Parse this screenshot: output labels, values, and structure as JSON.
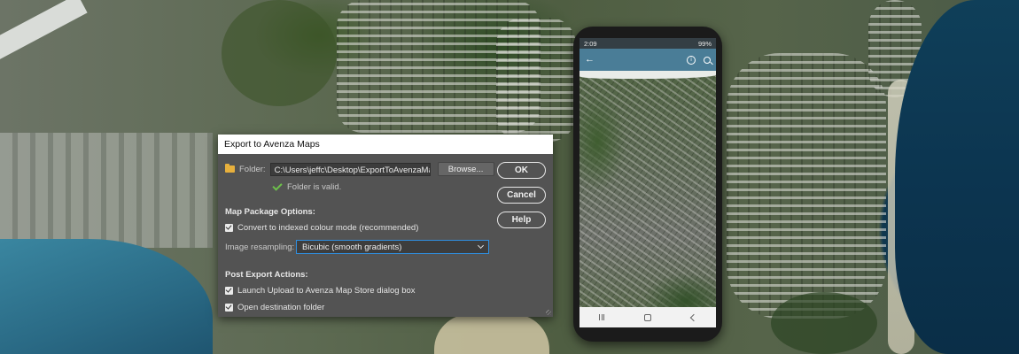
{
  "dialog": {
    "title": "Export to Avenza Maps",
    "folder_label": "Folder:",
    "folder_path": "C:\\Users\\jeffc\\Desktop\\ExportToAvenzaMaps",
    "browse_label": "Browse...",
    "folder_status": "Folder is valid.",
    "map_package_heading": "Map Package Options:",
    "convert_colour_label": "Convert to indexed colour mode (recommended)",
    "convert_colour_checked": true,
    "resampling_label": "Image resampling:",
    "resampling_value": "Bicubic (smooth gradients)",
    "post_export_heading": "Post Export Actions:",
    "launch_upload_label": "Launch Upload to Avenza Map Store dialog box",
    "launch_upload_checked": true,
    "open_folder_label": "Open destination folder",
    "open_folder_checked": true,
    "ok_label": "OK",
    "cancel_label": "Cancel",
    "help_label": "Help"
  },
  "phone": {
    "status_time": "2:09",
    "status_battery": "99%",
    "toolbar_icons": [
      "back-arrow-icon",
      "info-icon",
      "search-icon"
    ],
    "nav_icons": [
      "recent-apps-icon",
      "home-icon",
      "back-icon"
    ]
  },
  "colors": {
    "dialog_bg": "#535353",
    "app_bar": "#4a7d97",
    "status_ok": "#6dc04b",
    "focus_border": "#2f8fe0",
    "folder_icon": "#e7b03d"
  }
}
